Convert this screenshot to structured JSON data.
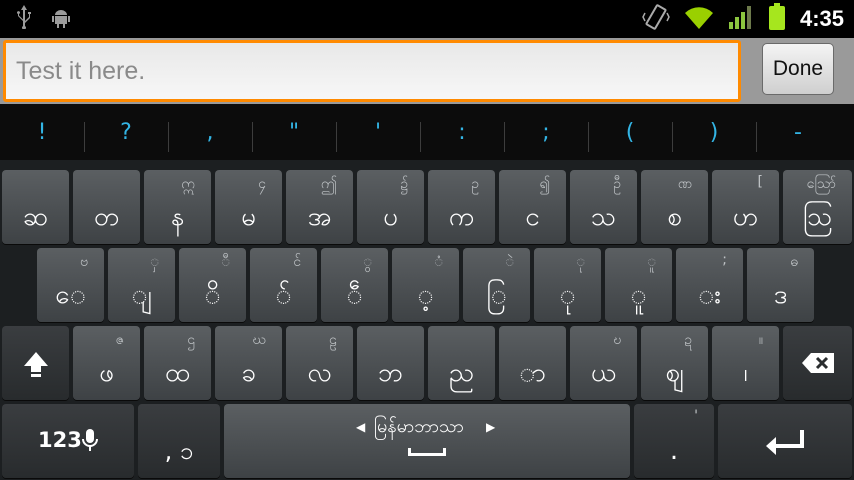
{
  "status": {
    "time": "4:35",
    "battery_color": "#a6e61e",
    "wifi_color": "#9ad000"
  },
  "input": {
    "placeholder": "Test it here.",
    "value": ""
  },
  "done_label": "Done",
  "suggestions": [
    "!",
    "?",
    ",",
    "\"",
    "'",
    ":",
    ";",
    "(",
    ")",
    "-"
  ],
  "keyboard": {
    "row1": [
      {
        "main": "ဆ",
        "hint": ""
      },
      {
        "main": "တ",
        "hint": ""
      },
      {
        "main": "န",
        "hint": "ဣ"
      },
      {
        "main": "မ",
        "hint": "၄"
      },
      {
        "main": "အ",
        "hint": "ဤ"
      },
      {
        "main": "ပ",
        "hint": "၌"
      },
      {
        "main": "က",
        "hint": "ဥ"
      },
      {
        "main": "င",
        "hint": "၍"
      },
      {
        "main": "သ",
        "hint": "ဦ"
      },
      {
        "main": "စ",
        "hint": "ဏ"
      },
      {
        "main": "ဟ",
        "hint": "["
      },
      {
        "main": "ဩ",
        "hint": "ဪ"
      }
    ],
    "row2": [
      {
        "main": "ေ",
        "hint": "ဗ"
      },
      {
        "main": "ျ",
        "hint": "ှ"
      },
      {
        "main": "ိ",
        "hint": "ီ"
      },
      {
        "main": "◌်",
        "hint": "င်"
      },
      {
        "main": "ဵ",
        "hint": "ွ"
      },
      {
        "main": "့",
        "hint": "ံ"
      },
      {
        "main": "ြ",
        "hint": "ဲ"
      },
      {
        "main": "ု",
        "hint": "ု"
      },
      {
        "main": "ူ",
        "hint": "ူ"
      },
      {
        "main": "း",
        "hint": ";"
      },
      {
        "main": "ဒ",
        "hint": "ဓ"
      }
    ],
    "row3": [
      {
        "main": "ဖ",
        "hint": "ဇ"
      },
      {
        "main": "ထ",
        "hint": "ဌ"
      },
      {
        "main": "ခ",
        "hint": "ဃ"
      },
      {
        "main": "လ",
        "hint": "ဠ"
      },
      {
        "main": "ဘ",
        "hint": ""
      },
      {
        "main": "ည",
        "hint": ""
      },
      {
        "main": "ာ",
        "hint": ""
      },
      {
        "main": "ယ",
        "hint": "ဎ"
      },
      {
        "main": "ဈ",
        "hint": "ဍ"
      },
      {
        "main": "၊",
        "hint": "။"
      }
    ],
    "symbols_label": "123",
    "comma_label": ", ၁",
    "space_label": "မြန်မာဘာသာ",
    "period_label": ".",
    "period_hint": "'"
  }
}
